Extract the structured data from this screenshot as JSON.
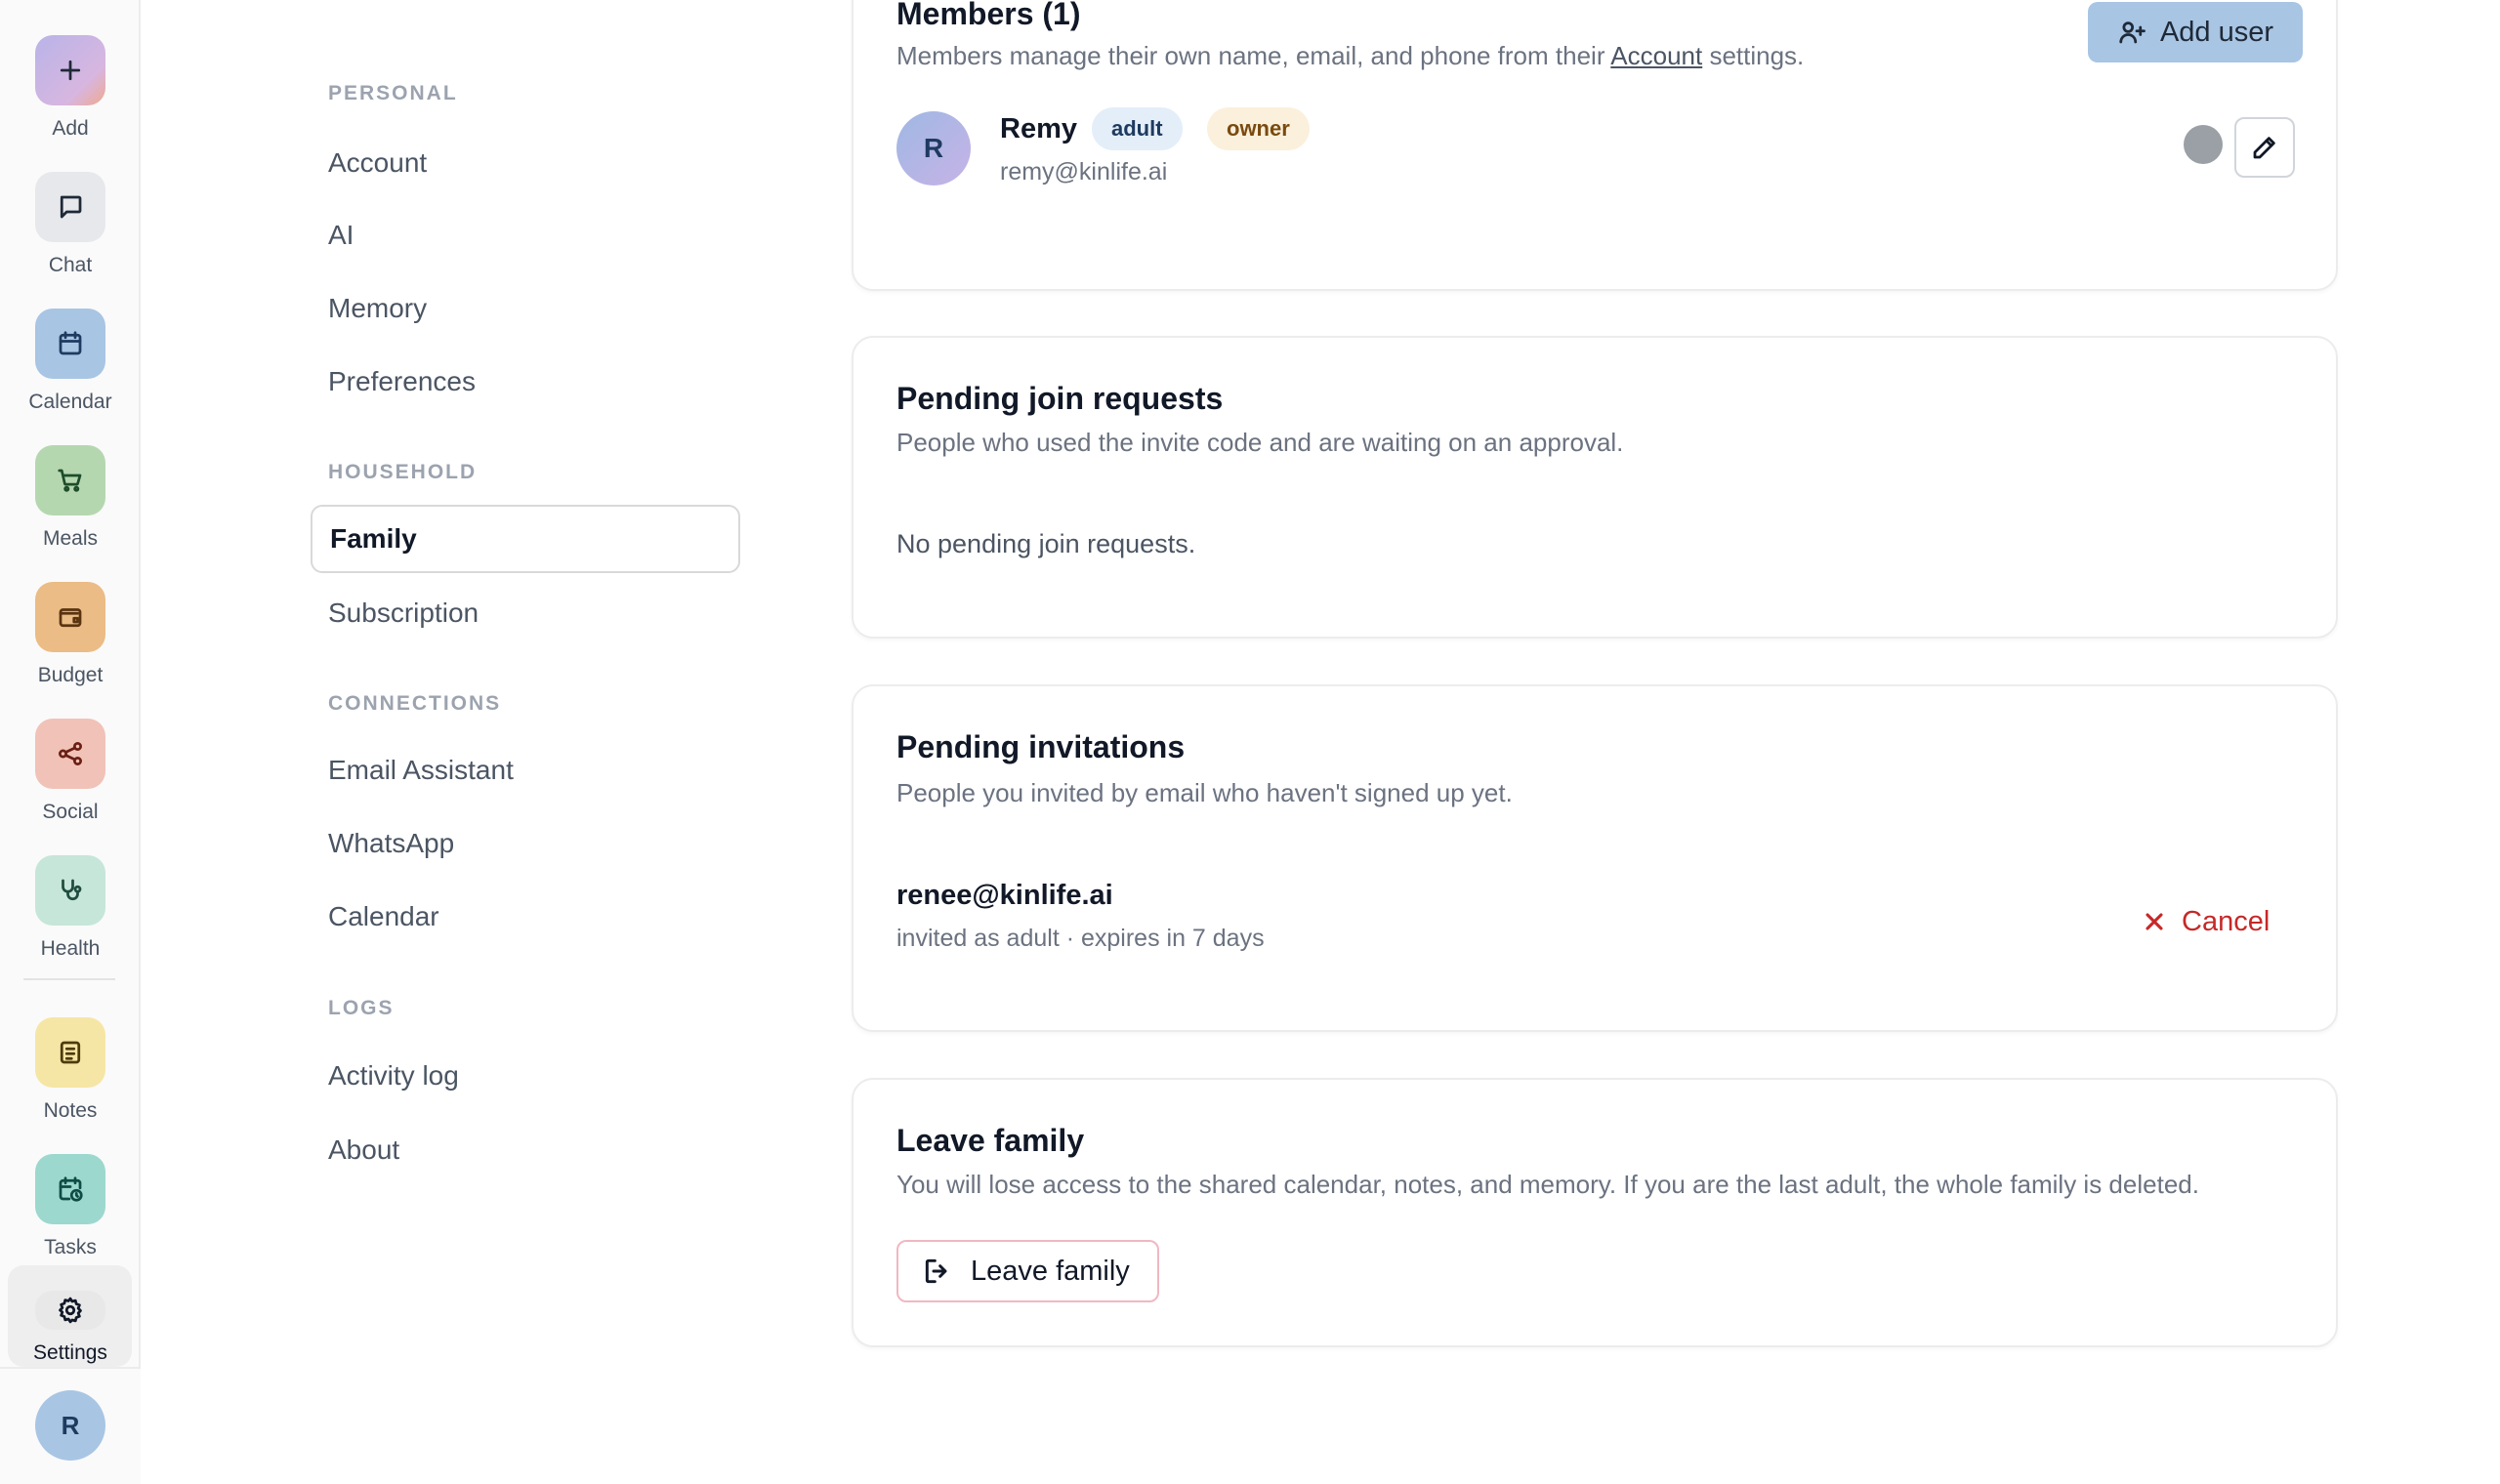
{
  "rail": {
    "items": [
      {
        "label": "Add",
        "icon": "plus-icon",
        "color": "#b9b4e8"
      },
      {
        "label": "Chat",
        "icon": "chat-bubble-icon",
        "color": "#e6e8ec"
      },
      {
        "label": "Calendar",
        "icon": "calendar-icon",
        "color": "#a8c5e4"
      },
      {
        "label": "Meals",
        "icon": "cart-icon",
        "color": "#b5d7b0"
      },
      {
        "label": "Budget",
        "icon": "wallet-icon",
        "color": "#ebbc85"
      },
      {
        "label": "Social",
        "icon": "share-icon",
        "color": "#f1c2b8"
      },
      {
        "label": "Health",
        "icon": "stethoscope-icon",
        "color": "#c6e6d9"
      },
      {
        "label": "Notes",
        "icon": "notes-icon",
        "color": "#f6e6a6"
      },
      {
        "label": "Tasks",
        "icon": "calendar-clock-icon",
        "color": "#9cd8ce"
      },
      {
        "label": "Settings",
        "icon": "gear-icon",
        "color": "#e8e8e8"
      }
    ],
    "user_initial": "R"
  },
  "nav": {
    "sections": {
      "personal": "PERSONAL",
      "household": "HOUSEHOLD",
      "connections": "CONNECTIONS",
      "logs": "LOGS"
    },
    "items": {
      "account": "Account",
      "ai": "AI",
      "memory": "Memory",
      "preferences": "Preferences",
      "family": "Family",
      "subscription": "Subscription",
      "email_assistant": "Email Assistant",
      "whatsapp": "WhatsApp",
      "calendar": "Calendar",
      "activity_log": "Activity log",
      "about": "About"
    },
    "active": "Family"
  },
  "members": {
    "title": "Members (1)",
    "desc_prefix": "Members manage their own name, email, and phone from their ",
    "desc_link": "Account",
    "desc_suffix": " settings.",
    "add_user_label": "Add user",
    "list": [
      {
        "initial": "R",
        "name": "Remy",
        "role": "adult",
        "tag": "owner",
        "email": "remy@kinlife.ai"
      }
    ]
  },
  "join_requests": {
    "title": "Pending join requests",
    "desc": "People who used the invite code and are waiting on an approval.",
    "empty": "No pending join requests."
  },
  "invitations": {
    "title": "Pending invitations",
    "desc": "People you invited by email who haven't signed up yet.",
    "list": [
      {
        "email": "renee@kinlife.ai",
        "meta": "invited as adult · expires in 7 days"
      }
    ],
    "cancel_label": "Cancel"
  },
  "leave": {
    "title": "Leave family",
    "desc": "You will lose access to the shared calendar, notes, and memory. If you are the last adult, the whole family is deleted.",
    "button_label": "Leave family"
  },
  "colors": {
    "accent": "#a8c5e4",
    "danger": "#c62828"
  }
}
